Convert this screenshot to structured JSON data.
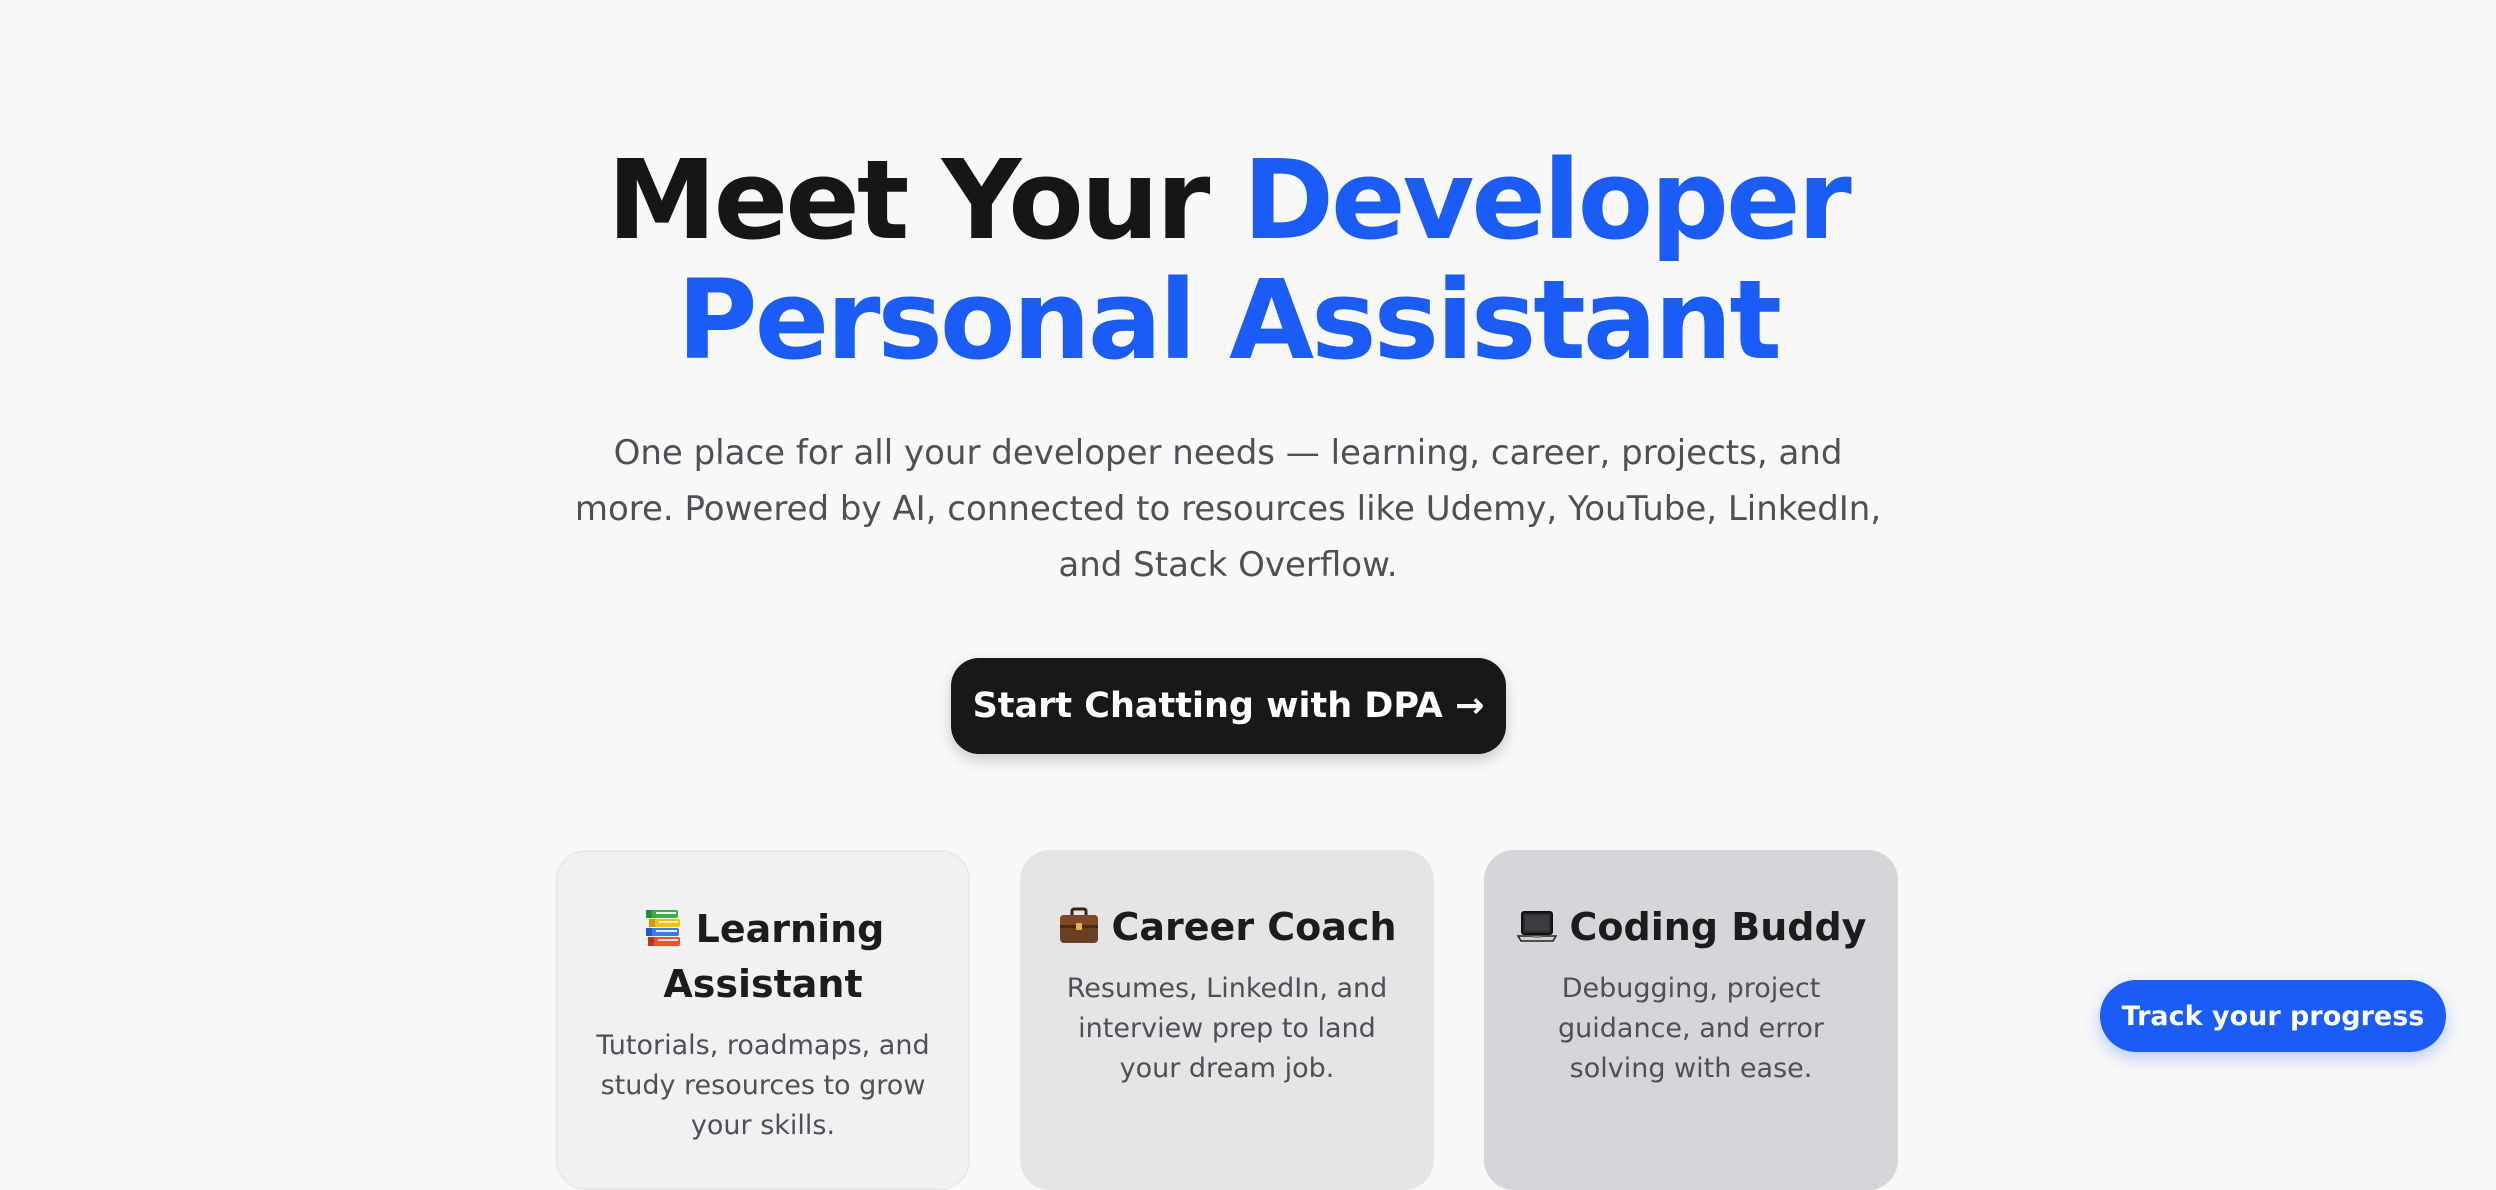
{
  "hero": {
    "title_dark": "Meet Your ",
    "title_accent_1": "Developer",
    "title_accent_2": "Personal Assistant",
    "subtitle": "One place for all your developer needs — learning, career, projects, and more. Powered by AI, connected to resources like Udemy, YouTube, LinkedIn, and Stack Overflow.",
    "cta_label": "Start Chatting with DPA →"
  },
  "features": [
    {
      "icon": "books-icon",
      "title": "Learning Assistant",
      "description": "Tutorials, roadmaps, and study resources to grow your skills."
    },
    {
      "icon": "briefcase-icon",
      "title": "Career Coach",
      "description": "Resumes, LinkedIn, and interview prep to land your dream job."
    },
    {
      "icon": "laptop-icon",
      "title": "Coding Buddy",
      "description": "Debugging, project guidance, and error solving with ease."
    }
  ],
  "floating_button": {
    "label": "Track your progress"
  },
  "colors": {
    "accent": "#1a5cf5",
    "dark": "#18181a",
    "background": "#f8f8f8"
  }
}
